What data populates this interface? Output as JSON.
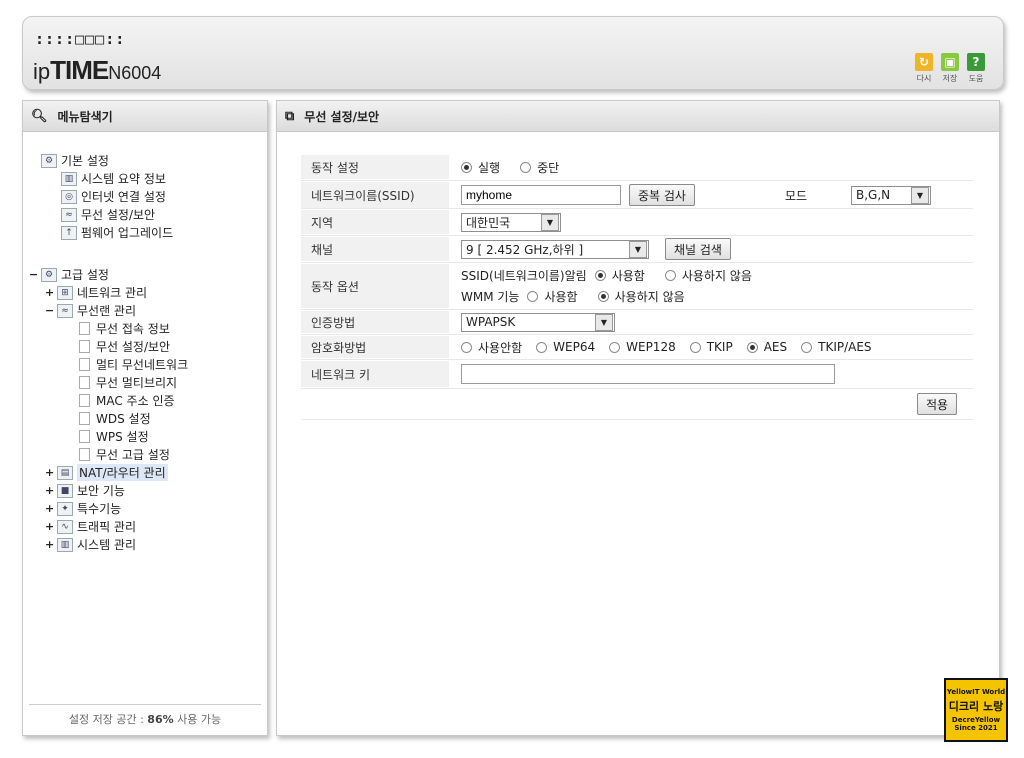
{
  "header": {
    "brand_small": "::::□□□::",
    "brand_ip": "ip",
    "brand_time": "TIME",
    "brand_model": "N6004",
    "icons": [
      {
        "icon": "refresh-icon",
        "glyph": "↻",
        "color": "#f0b429",
        "label": "다시"
      },
      {
        "icon": "save-icon",
        "glyph": "▣",
        "color": "#8ac840",
        "label": "저장"
      },
      {
        "icon": "help-icon",
        "glyph": "?",
        "color": "#3a9a3a",
        "label": "도움"
      }
    ]
  },
  "sidebar": {
    "title": "메뉴탐색기",
    "footer_prefix": "설정 저장 공간 : ",
    "footer_value": "86%",
    "footer_suffix": " 사용 가능",
    "items": [
      {
        "label": "기본 설정"
      },
      {
        "label": "시스템 요약 정보"
      },
      {
        "label": "인터넷 연결 설정"
      },
      {
        "label": "무선 설정/보안"
      },
      {
        "label": "펌웨어 업그레이드"
      },
      {
        "label": "고급 설정"
      },
      {
        "label": "네트워크 관리"
      },
      {
        "label": "무선랜 관리"
      },
      {
        "label": "무선 접속 정보"
      },
      {
        "label": "무선 설정/보안"
      },
      {
        "label": "멀티 무선네트워크"
      },
      {
        "label": "무선 멀티브리지"
      },
      {
        "label": "MAC 주소 인증"
      },
      {
        "label": "WDS 설정"
      },
      {
        "label": "WPS 설정"
      },
      {
        "label": "무선 고급 설정"
      },
      {
        "label": "NAT/라우터 관리"
      },
      {
        "label": "보안 기능"
      },
      {
        "label": "특수기능"
      },
      {
        "label": "트래픽 관리"
      },
      {
        "label": "시스템 관리"
      }
    ]
  },
  "main": {
    "title": "무선 설정/보안",
    "op": {
      "label": "동작 설정",
      "on": "실행",
      "off": "중단"
    },
    "ssid": {
      "label": "네트워크이름(SSID)",
      "value": "myhome",
      "check_btn": "중복 검사",
      "mode_label": "모드",
      "mode_value": "B,G,N"
    },
    "region": {
      "label": "지역",
      "value": "대한민국"
    },
    "channel": {
      "label": "채널",
      "value": "9 [ 2.452 GHz,하위 ]",
      "search_btn": "채널 검색"
    },
    "options": {
      "label": "동작 옵션",
      "ssid_alarm": "SSID(네트워크이름)알림",
      "wmm": "WMM 기능",
      "use": "사용함",
      "nouse": "사용하지 않음"
    },
    "auth": {
      "label": "인증방법",
      "value": "WPAPSK"
    },
    "enc": {
      "label": "암호화방법",
      "options": [
        "사용안함",
        "WEP64",
        "WEP128",
        "TKIP",
        "AES",
        "TKIP/AES"
      ]
    },
    "key": {
      "label": "네트워크 키",
      "value": ""
    },
    "apply_btn": "적용"
  },
  "watermark": {
    "line1": "YellowIT World",
    "line2": "디크리 노랑",
    "line3": "DecreYellow",
    "line4": "Since 2021"
  }
}
